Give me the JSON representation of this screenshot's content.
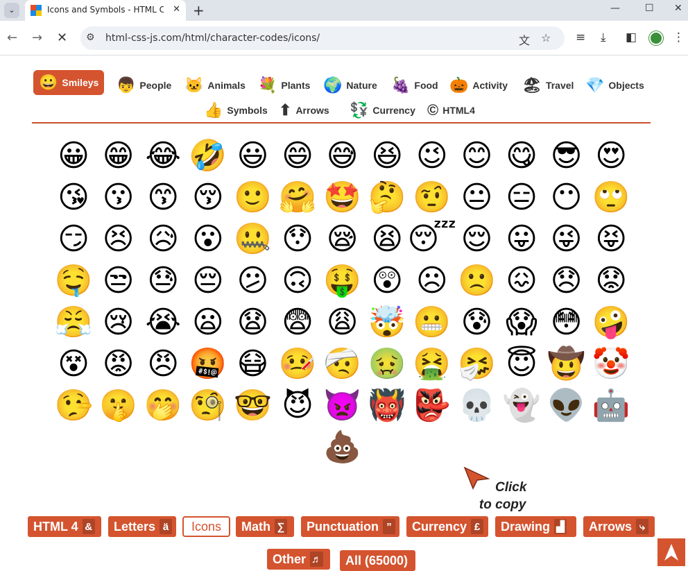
{
  "browser": {
    "tab_title": "Icons and Symbols - HTML CH",
    "url": "html-css-js.com/html/character-codes/icons/",
    "new_tab_label": "+",
    "close_label": "✕"
  },
  "categories": [
    {
      "label": "Smileys",
      "icon": "😀",
      "active": true
    },
    {
      "label": "People",
      "icon": "👦"
    },
    {
      "label": "Animals",
      "icon": "🐱"
    },
    {
      "label": "Plants",
      "icon": "💐"
    },
    {
      "label": "Nature",
      "icon": "🌍"
    },
    {
      "label": "Food",
      "icon": "🍇"
    },
    {
      "label": "Activity",
      "icon": "🎃"
    },
    {
      "label": "Travel",
      "icon": "🏖"
    },
    {
      "label": "Objects",
      "icon": "💎"
    },
    {
      "label": "Symbols",
      "icon": "👍"
    },
    {
      "label": "Arrows",
      "icon": "⬆"
    },
    {
      "label": "Currency",
      "icon": "💱"
    },
    {
      "label": "HTML4",
      "icon": "©"
    }
  ],
  "emojis": [
    "😀",
    "😁",
    "😂",
    "🤣",
    "😃",
    "😄",
    "😅",
    "😆",
    "😉",
    "😊",
    "😋",
    "😎",
    "😍",
    "😘",
    "😗",
    "😙",
    "😚",
    "🙂",
    "🤗",
    "🤩",
    "🤔",
    "🤨",
    "😐",
    "😑",
    "😶",
    "🙄",
    "😏",
    "😣",
    "😥",
    "😮",
    "🤐",
    "😯",
    "😪",
    "😫",
    "😴",
    "😌",
    "😛",
    "😜",
    "😝",
    "🤤",
    "😒",
    "😓",
    "😔",
    "😕",
    "🙃",
    "🤑",
    "😲",
    "☹",
    "🙁",
    "😖",
    "😞",
    "😟",
    "😤",
    "😢",
    "😭",
    "😦",
    "😧",
    "😨",
    "😩",
    "🤯",
    "😬",
    "😰",
    "😱",
    "😳",
    "🤪",
    "😵",
    "😡",
    "😠",
    "🤬",
    "😷",
    "🤒",
    "🤕",
    "🤢",
    "🤮",
    "🤧",
    "😇",
    "🤠",
    "🤡",
    "🤥",
    "🤫",
    "🤭",
    "🧐",
    "🤓",
    "😈",
    "👿",
    "👹",
    "👺",
    "💀",
    "👻",
    "👽",
    "🤖",
    "💩"
  ],
  "hint": {
    "line1": "Click",
    "line2": "to copy"
  },
  "bottom_buttons": [
    {
      "label": "HTML 4",
      "glyph": "&"
    },
    {
      "label": "Letters",
      "glyph": "ä"
    },
    {
      "label": "Icons",
      "glyph": "",
      "active": true
    },
    {
      "label": "Math",
      "glyph": "∑"
    },
    {
      "label": "Punctuation",
      "glyph": "”"
    },
    {
      "label": "Currency",
      "glyph": "£"
    },
    {
      "label": "Drawing",
      "glyph": "▟"
    },
    {
      "label": "Arrows",
      "glyph": "⤷"
    },
    {
      "label": "Other",
      "glyph": "♬"
    },
    {
      "label": "All (65000)",
      "glyph": ""
    }
  ],
  "colors": {
    "accent": "#d4542f",
    "tabstrip": "#dfe3ea",
    "omnibox": "#eef1f6"
  }
}
